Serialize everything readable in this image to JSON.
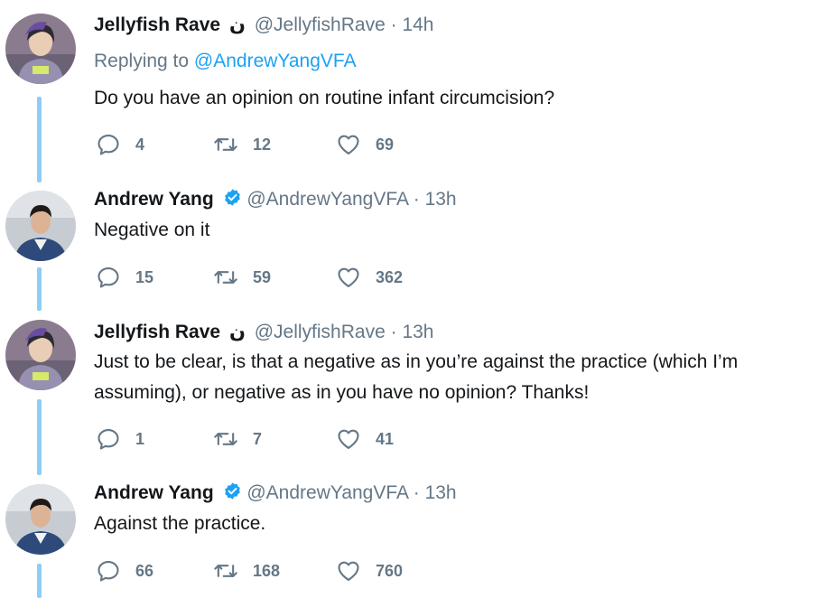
{
  "tweets": [
    {
      "name": "Jellyfish Rave",
      "symbol": "ن",
      "verified": false,
      "handle": "@JellyfishRave",
      "dot": "·",
      "time": "14h",
      "replying_prefix": "Replying to",
      "replying_to": "@AndrewYangVFA",
      "text": "Do you have an opinion on routine infant circumcision?",
      "replies": "4",
      "retweets": "12",
      "likes": "69"
    },
    {
      "name": "Andrew Yang",
      "verified": true,
      "handle": "@AndrewYangVFA",
      "dot": "·",
      "time": "13h",
      "text": "Negative on it",
      "replies": "15",
      "retweets": "59",
      "likes": "362"
    },
    {
      "name": "Jellyfish Rave",
      "symbol": "ن",
      "verified": false,
      "handle": "@JellyfishRave",
      "dot": "·",
      "time": "13h",
      "text_line1": "Just to be clear, is that a negative as in you’re against the practice (which I’m",
      "text_line2": "assuming), or negative as in you have no opinion? Thanks!",
      "replies": "1",
      "retweets": "7",
      "likes": "41"
    },
    {
      "name": "Andrew Yang",
      "verified": true,
      "handle": "@AndrewYangVFA",
      "dot": "·",
      "time": "13h",
      "text": "Against the practice.",
      "replies": "66",
      "retweets": "168",
      "likes": "760"
    }
  ],
  "colors": {
    "accent": "#1da1f2",
    "secondary": "#657786",
    "thread_line": "#8ecdf8",
    "text": "#14171a"
  }
}
